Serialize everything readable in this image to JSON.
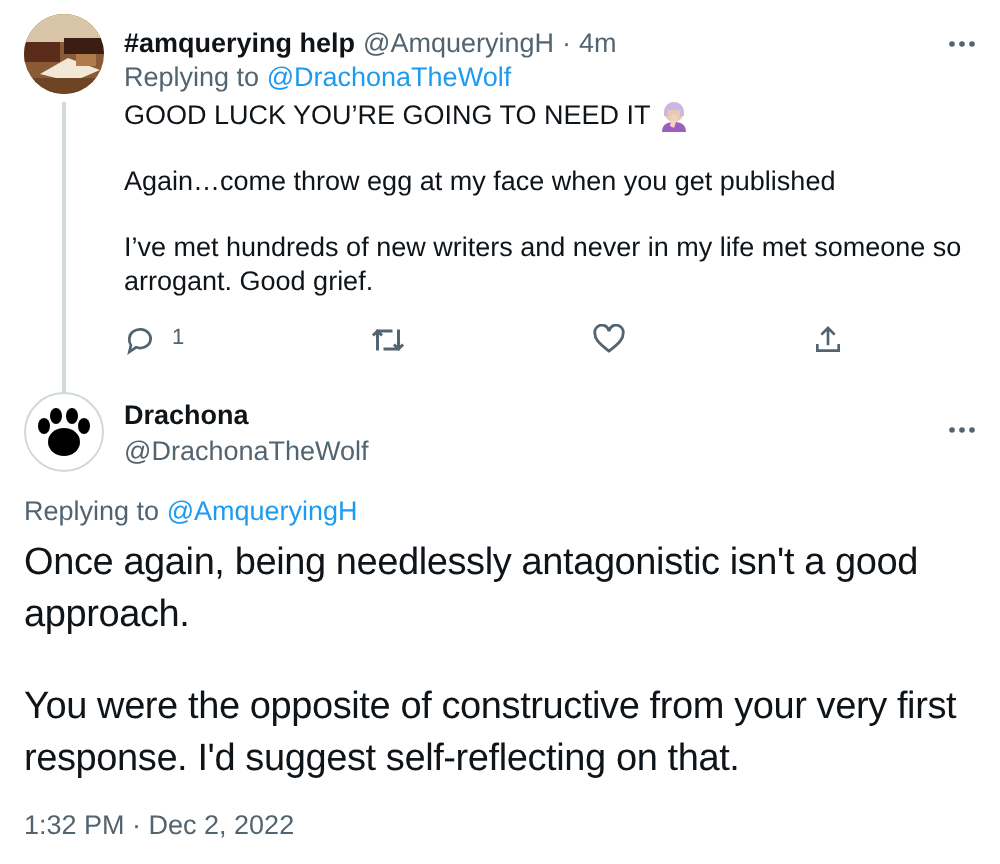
{
  "reply": {
    "display_name": "#amquerying help",
    "handle": "@AmqueryingH",
    "separator": "·",
    "time": "4m",
    "replying_label": "Replying to",
    "replying_handle": "@DrachonaTheWolf",
    "paragraphs": [
      {
        "text": "GOOD LUCK YOU’RE GOING TO NEED IT",
        "kind": "with_emoji"
      },
      {
        "text": "Again…come throw egg at my face when you get published",
        "kind": "plain"
      },
      {
        "text": "I’ve met hundreds of new writers and never in my life met someone so arrogant. Good grief.",
        "kind": "plain"
      }
    ],
    "actions": [
      {
        "kind": "reply",
        "count": "1"
      },
      {
        "kind": "retweet"
      },
      {
        "kind": "like"
      },
      {
        "kind": "share"
      }
    ]
  },
  "main": {
    "display_name": "Drachona",
    "handle": "@DrachonaTheWolf",
    "replying_label": "Replying to",
    "replying_handle": "@AmqueryingH",
    "paragraphs": [
      "Once again, being needlessly antagonistic isn't a good approach.",
      "You were the opposite of constructive from your very first response. I'd suggest self-reflecting on that."
    ],
    "timestamp": "1:32 PM · Dec 2, 2022"
  }
}
